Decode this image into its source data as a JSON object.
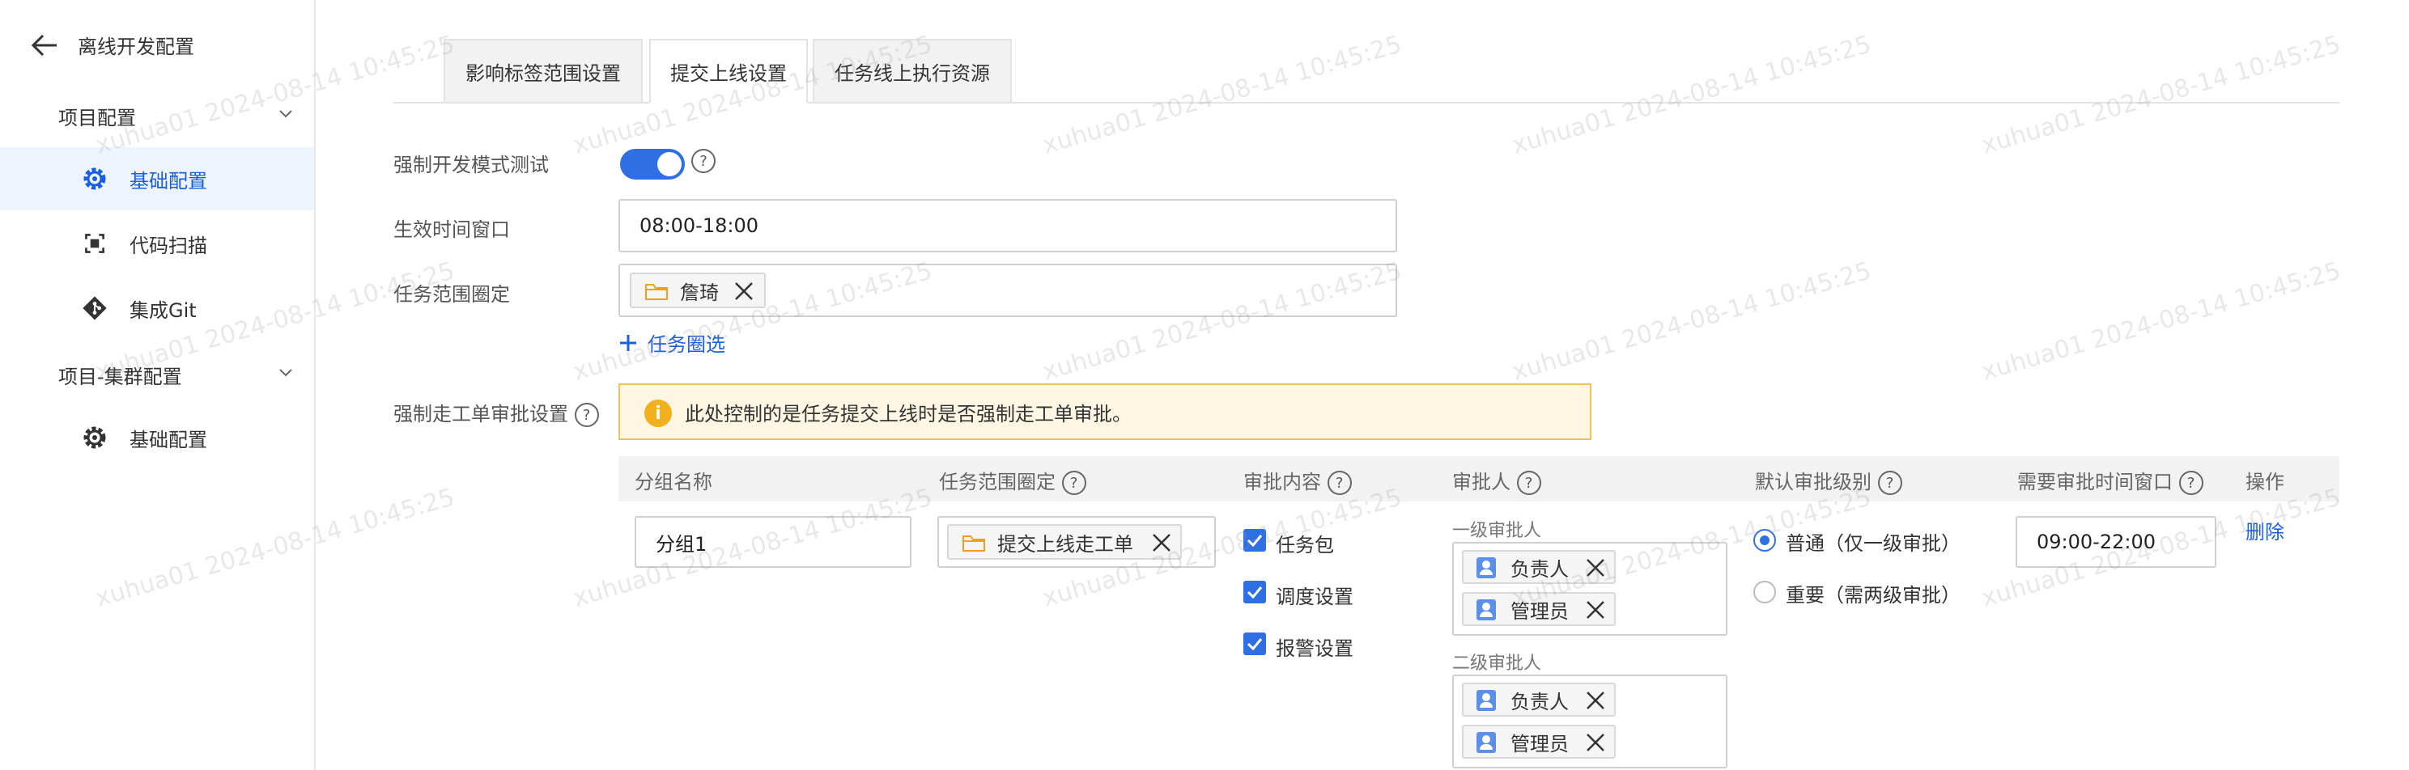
{
  "sidebar": {
    "back_title": "离线开发配置",
    "groups": [
      {
        "label": "项目配置",
        "items": [
          {
            "label": "基础配置",
            "icon": "gear-icon",
            "active": true
          },
          {
            "label": "代码扫描",
            "icon": "scan-icon",
            "active": false
          },
          {
            "label": "集成Git",
            "icon": "git-icon",
            "active": false
          }
        ]
      },
      {
        "label": "项目-集群配置",
        "items": [
          {
            "label": "基础配置",
            "icon": "gear-icon",
            "active": false
          }
        ]
      }
    ]
  },
  "tabs": [
    {
      "label": "影响标签范围设置",
      "active": false
    },
    {
      "label": "提交上线设置",
      "active": true
    },
    {
      "label": "任务线上执行资源",
      "active": false
    }
  ],
  "form": {
    "force_dev_mode_label": "强制开发模式测试",
    "force_dev_mode_on": true,
    "time_window_label": "生效时间窗口",
    "time_window_value": "08:00-18:00",
    "task_scope_label": "任务范围圈定",
    "task_scope_chip": "詹琦",
    "add_task_label": "任务圈选",
    "force_ticket_label": "强制走工单审批设置",
    "alert_text": "此处控制的是任务提交上线时是否强制走工单审批。"
  },
  "table": {
    "headers": {
      "group_name": "分组名称",
      "task_scope": "任务范围圈定",
      "approval_content": "审批内容",
      "approver": "审批人",
      "default_level": "默认审批级别",
      "time_window": "需要审批时间窗口",
      "operation": "操作"
    },
    "row": {
      "group_name": "分组1",
      "task_scope_chip": "提交上线走工单",
      "contents": [
        {
          "label": "任务包",
          "checked": true
        },
        {
          "label": "调度设置",
          "checked": true
        },
        {
          "label": "报警设置",
          "checked": true
        }
      ],
      "level1_label": "一级审批人",
      "level1_approvers": [
        "负责人",
        "管理员"
      ],
      "level2_label": "二级审批人",
      "level2_approvers": [
        "负责人",
        "管理员"
      ],
      "levels": [
        {
          "label": "普通（仅一级审批）",
          "selected": true
        },
        {
          "label": "重要（需两级审批）",
          "selected": false
        }
      ],
      "time_window": "09:00-22:00",
      "delete_label": "删除"
    }
  },
  "watermark": "xuhua01 2024-08-14 10:45:25",
  "colors": {
    "accent": "#2f6fe4",
    "alert_bg": "#fdf6e3",
    "alert_border": "#f0c35a",
    "warning_icon": "#f2b01e"
  }
}
